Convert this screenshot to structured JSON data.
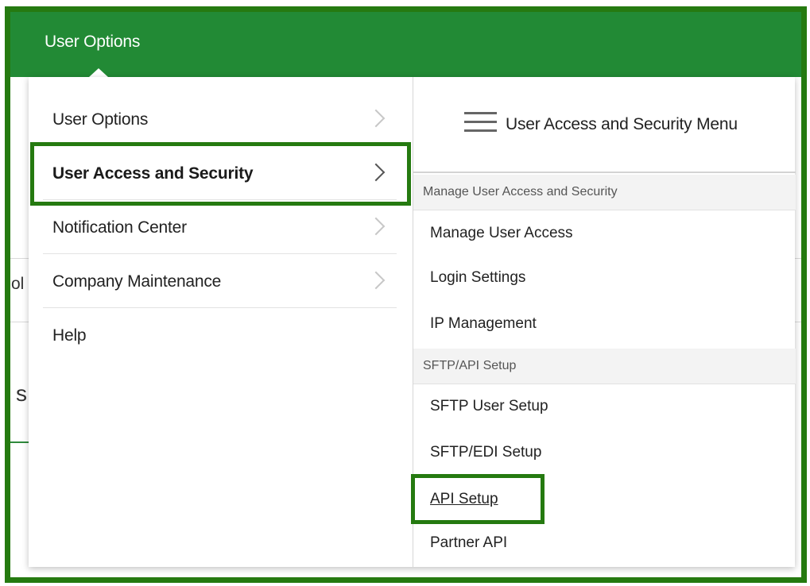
{
  "header": {
    "title": "User Options"
  },
  "background": {
    "fragment_left": "ol",
    "fragment_heading": "s"
  },
  "nav": {
    "items": [
      {
        "label": "User Options",
        "has_submenu": true
      },
      {
        "label": "User Access and Security",
        "has_submenu": true,
        "selected": true
      },
      {
        "label": "Notification Center",
        "has_submenu": true
      },
      {
        "label": "Company Maintenance",
        "has_submenu": true
      },
      {
        "label": "Help",
        "has_submenu": false
      }
    ]
  },
  "submenu": {
    "title": "User Access and Security Menu",
    "sections": [
      {
        "heading": "Manage User Access and Security",
        "links": [
          "Manage User Access",
          "Login Settings",
          "IP Management"
        ]
      },
      {
        "heading": "SFTP/API Setup",
        "links": [
          "SFTP User Setup",
          "SFTP/EDI Setup",
          "API Setup",
          "Partner API"
        ]
      }
    ]
  },
  "colors": {
    "topbar": "#228a35",
    "highlight": "#257a10"
  },
  "icons": {
    "menu": "hamburger-icon",
    "submenu": "chevron-right-icon"
  }
}
